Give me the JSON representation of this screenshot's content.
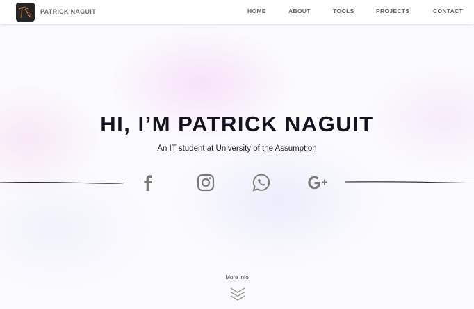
{
  "nav": {
    "brand": "PATRICK NAGUIT",
    "links": [
      "HOME",
      "ABOUT",
      "TOOLS",
      "PROJECTS",
      "CONTACT"
    ]
  },
  "hero": {
    "title": "HI, I’M PATRICK NAGUIT",
    "subtitle": "An IT student at University of the Assumption"
  },
  "social_icons": [
    "facebook-icon",
    "instagram-icon",
    "whatsapp-icon",
    "google-plus-icon"
  ],
  "more_info": {
    "label": "More info",
    "icon": "chevrons-down-icon"
  },
  "colors": {
    "title": "#14121f",
    "nav_text": "#666666",
    "icon_gray": "#7a7a7a",
    "rule": "#222222"
  }
}
